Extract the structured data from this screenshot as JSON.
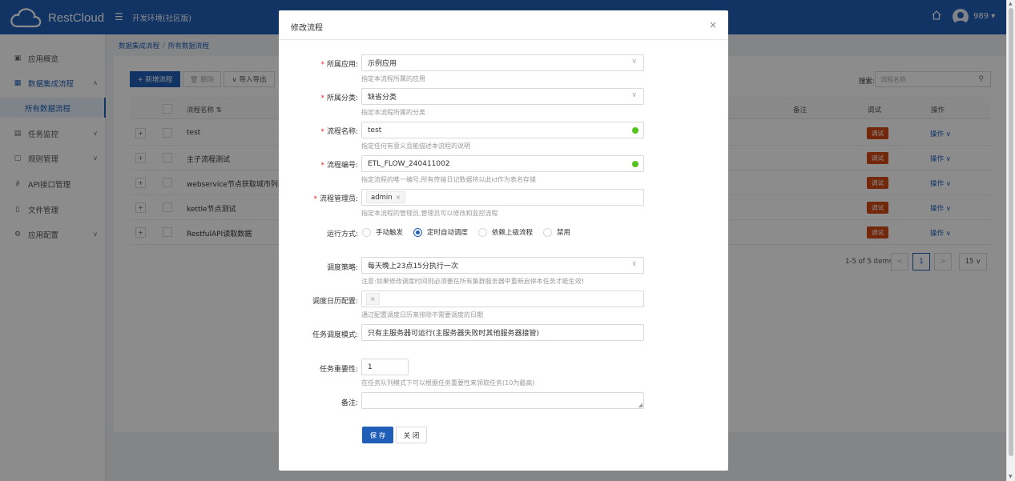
{
  "header": {
    "logo_text": "RestCloud",
    "env_label": "开发环境(社区版)",
    "user": "989 ▾"
  },
  "sidebar": {
    "items": [
      {
        "label": "应用概览",
        "icon": "overview-icon"
      },
      {
        "label": "数据集成流程",
        "icon": "grid-icon",
        "sub": "所有数据流程"
      },
      {
        "label": "任务监控",
        "icon": "monitor-icon"
      },
      {
        "label": "规则管理",
        "icon": "rule-icon"
      },
      {
        "label": "API接口管理",
        "icon": "link-icon"
      },
      {
        "label": "文件管理",
        "icon": "file-icon"
      },
      {
        "label": "应用配置",
        "icon": "settings-icon"
      }
    ]
  },
  "breadcrumb": {
    "root": "数据集成流程",
    "sep": "/",
    "current": "所有数据流程"
  },
  "toolbar": {
    "new_label": "+ 新增流程",
    "delete_label": "🗑 删除",
    "import_label": "∨ 导入导出",
    "search_label": "搜索:",
    "search_placeholder": "流程名称"
  },
  "table": {
    "headers": {
      "name": "流程名称 ⇅",
      "remark": "备注",
      "debug": "调试",
      "action": "操作"
    },
    "rows": [
      {
        "name": "test"
      },
      {
        "name": "主子流程测试"
      },
      {
        "name": "webservice节点获取城市列表"
      },
      {
        "name": "kettle节点测试"
      },
      {
        "name": "RestfulAPI读取数据"
      }
    ],
    "debug_label": "调试",
    "action_label": "操作 ∨"
  },
  "pager": {
    "info": "1-5 of 5 items",
    "prev": "<",
    "current": "1",
    "next": ">",
    "size": "15 ∨"
  },
  "modal": {
    "title": "修改流程",
    "close": "×",
    "fields": {
      "app": {
        "label": "所属应用:",
        "value": "示例应用",
        "help": "指定本流程所属的应用"
      },
      "category": {
        "label": "所属分类:",
        "value": "缺省分类",
        "help": "指定本流程所属的分类"
      },
      "name": {
        "label": "流程名称:",
        "value": "test",
        "help": "指定任何有意义且能描述本流程的说明"
      },
      "code": {
        "label": "流程编号:",
        "value": "ETL_FLOW_240411002",
        "help": "指定流程的唯一编号,所有传输日记数据将以此id作为表名存储"
      },
      "managers": {
        "label": "流程管理员:",
        "tag": "admin",
        "help": "指定本流程的管理员,管理员可以修改和监控流程"
      },
      "run_mode": {
        "label": "运行方式:",
        "options": [
          "手动触发",
          "定时自动调度",
          "依赖上级流程",
          "禁用"
        ],
        "selected": "定时自动调度"
      },
      "strategy": {
        "label": "调度策略:",
        "value": "每天晚上23点15分执行一次",
        "help": "注意:如果修改调度时间则必须要在所有集群服务器中重新启停本任务才能生效!"
      },
      "calendar": {
        "label": "调度日历配置:",
        "help": "通过配置调度日历来排除不需要调度的日期"
      },
      "sched_mode": {
        "label": "任务调度模式:",
        "value": "只有主服务器可运行(主服务器失败时其他服务器接管)"
      },
      "priority": {
        "label": "任务重要性:",
        "value": "1",
        "help": "在任务队列模式下可以根据任务重要性来领取任务(10为最高)"
      },
      "remark": {
        "label": "备注:"
      }
    },
    "save_label": "保 存",
    "close_label": "关 闭"
  },
  "colors": {
    "primary": "#1f5fb8",
    "debug_button": "#d24a16",
    "required": "#f5222d",
    "valid": "#52c41a"
  }
}
